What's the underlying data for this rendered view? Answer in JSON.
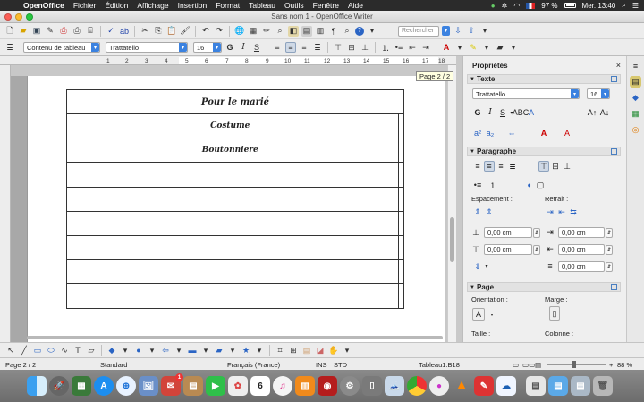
{
  "menubar": {
    "app": "OpenOffice",
    "items": [
      "Fichier",
      "Édition",
      "Affichage",
      "Insertion",
      "Format",
      "Tableau",
      "Outils",
      "Fenêtre",
      "Aide"
    ],
    "battery": "97 %",
    "clock": "Mer. 13:40"
  },
  "window": {
    "title": "Sans nom 1 - OpenOffice Writer"
  },
  "toolbar": {
    "search_placeholder": "Rechercher",
    "style_value": "Contenu de tableau",
    "font_value": "Trattatello",
    "size_value": "16",
    "bold": "G",
    "italic": "I",
    "underline": "S"
  },
  "ruler": {
    "ticks": [
      "1",
      "2",
      "3",
      "4",
      "5",
      "6",
      "7",
      "8",
      "9",
      "10",
      "11",
      "12",
      "13",
      "14",
      "15",
      "16",
      "17",
      "18"
    ]
  },
  "tooltip": "Page 2 / 2",
  "table": {
    "title": "Pour le marié",
    "rows": [
      "Costume",
      "Boutonniere",
      "",
      "",
      "",
      "",
      "",
      ""
    ]
  },
  "sidebar": {
    "title": "Propriétés",
    "texte": {
      "label": "Texte",
      "font": "Trattatello",
      "size": "16",
      "bold": "G",
      "italic": "I",
      "underline": "S"
    },
    "paragraphe": {
      "label": "Paragraphe",
      "spacing_label": "Espacement :",
      "indent_label": "Retrait :",
      "above": "0,00 cm",
      "below": "0,00 cm",
      "before_text": "0,00 cm",
      "after_text": "0,00 cm",
      "first_line": "0,00 cm"
    },
    "page": {
      "label": "Page",
      "orientation_label": "Orientation :",
      "margin_label": "Marge :",
      "size_label": "Taille :",
      "columns_label": "Colonne :"
    }
  },
  "statusbar": {
    "page": "Page 2 / 2",
    "style": "Standard",
    "language": "Français (France)",
    "ins": "INS",
    "std": "STD",
    "cell": "Tableau1:B18",
    "zoom": "88 %"
  },
  "dock": {
    "calendar_day": "6",
    "badge": "1"
  }
}
